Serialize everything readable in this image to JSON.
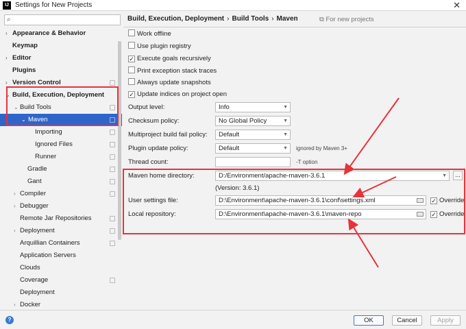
{
  "window": {
    "title": "Settings for New Projects",
    "app_icon_text": "IJ",
    "close_glyph": "✕"
  },
  "search": {
    "placeholder": "",
    "value": ""
  },
  "tree": [
    {
      "label": "Appearance & Behavior",
      "arrow": "›",
      "bold": true
    },
    {
      "label": "Keymap",
      "arrow": "",
      "bold": true
    },
    {
      "label": "Editor",
      "arrow": "›",
      "bold": true
    },
    {
      "label": "Plugins",
      "arrow": "",
      "bold": true
    },
    {
      "label": "Version Control",
      "arrow": "›",
      "bold": true
    },
    {
      "label": "Build, Execution, Deployment",
      "arrow": "⌄",
      "bold": true
    },
    {
      "label": "Build Tools",
      "arrow": "⌄",
      "bold": false
    },
    {
      "label": "Maven",
      "arrow": "⌄",
      "bold": false,
      "selected": true
    },
    {
      "label": "Importing",
      "arrow": "",
      "bold": false
    },
    {
      "label": "Ignored Files",
      "arrow": "",
      "bold": false
    },
    {
      "label": "Runner",
      "arrow": "",
      "bold": false
    },
    {
      "label": "Gradle",
      "arrow": "",
      "bold": false
    },
    {
      "label": "Gant",
      "arrow": "",
      "bold": false
    },
    {
      "label": "Compiler",
      "arrow": "›",
      "bold": false
    },
    {
      "label": "Debugger",
      "arrow": "›",
      "bold": false
    },
    {
      "label": "Remote Jar Repositories",
      "arrow": "",
      "bold": false
    },
    {
      "label": "Deployment",
      "arrow": "›",
      "bold": false
    },
    {
      "label": "Arquillian Containers",
      "arrow": "",
      "bold": false
    },
    {
      "label": "Application Servers",
      "arrow": "",
      "bold": false
    },
    {
      "label": "Clouds",
      "arrow": "",
      "bold": false
    },
    {
      "label": "Coverage",
      "arrow": "",
      "bold": false
    },
    {
      "label": "Deployment",
      "arrow": "",
      "bold": false
    },
    {
      "label": "Docker",
      "arrow": "›",
      "bold": false
    }
  ],
  "breadcrumb": {
    "items": [
      "Build, Execution, Deployment",
      "Build Tools",
      "Maven"
    ],
    "separator": "›"
  },
  "for_new_projects": "For new projects",
  "checkboxes": [
    {
      "label": "Work offline",
      "checked": false
    },
    {
      "label": "Use plugin registry",
      "checked": false
    },
    {
      "label": "Execute goals recursively",
      "checked": true
    },
    {
      "label": "Print exception stack traces",
      "checked": false
    },
    {
      "label": "Always update snapshots",
      "checked": false
    },
    {
      "label": "Update indices on project open",
      "checked": true
    }
  ],
  "selects": [
    {
      "label": "Output level:",
      "value": "Info"
    },
    {
      "label": "Checksum policy:",
      "value": "No Global Policy"
    },
    {
      "label": "Multiproject build fail policy:",
      "value": "Default"
    },
    {
      "label": "Plugin update policy:",
      "value": "Default",
      "hint": "ignored by Maven 3+"
    }
  ],
  "thread_count": {
    "label": "Thread count:",
    "value": "",
    "hint": "-T option"
  },
  "maven_home": {
    "label": "Maven home directory:",
    "value": "D:/Environment/apache-maven-3.6.1",
    "version": "(Version: 3.6.1)",
    "browse_label": "..."
  },
  "user_settings": {
    "label": "User settings file:",
    "value": "D:\\Environment\\apache-maven-3.6.1\\conf\\settings.xml",
    "override_label": "Override",
    "override_checked": true
  },
  "local_repo": {
    "label": "Local repository:",
    "value": "D:\\Environment\\apache-maven-3.6.1\\maven-repo",
    "override_label": "Override",
    "override_checked": true
  },
  "buttons": {
    "help": "?",
    "ok": "OK",
    "cancel": "Cancel",
    "apply": "Apply"
  },
  "colors": {
    "highlight": "#e8323a",
    "selection": "#2f65ca"
  },
  "icons": {
    "search": "search-icon",
    "folder": "folder-icon",
    "settings": "project-settings-icon"
  }
}
